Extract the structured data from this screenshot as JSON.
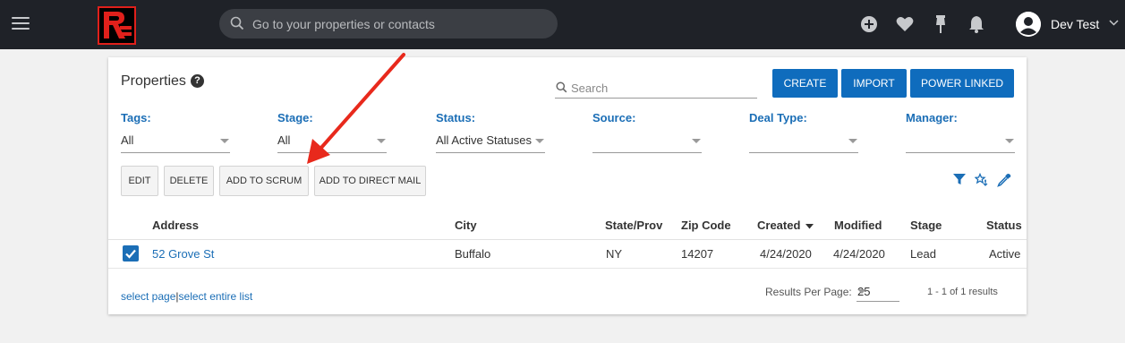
{
  "topbar": {
    "search_placeholder": "Go to your properties or contacts",
    "user_name": "Dev Test",
    "icons": [
      "hamburger-icon",
      "add-circle-icon",
      "heart-icon",
      "pin-icon",
      "bell-icon",
      "user-avatar-icon",
      "chevron-down-icon"
    ]
  },
  "card": {
    "title": "Properties",
    "search_placeholder": "Search",
    "buttons": {
      "create": "CREATE",
      "import": "IMPORT",
      "power_linked": "POWER LINKED"
    },
    "filters": [
      {
        "label": "Tags:",
        "value": "All"
      },
      {
        "label": "Stage:",
        "value": "All"
      },
      {
        "label": "Status:",
        "value": "All Active Statuses"
      },
      {
        "label": "Source:",
        "value": ""
      },
      {
        "label": "Deal Type:",
        "value": ""
      },
      {
        "label": "Manager:",
        "value": ""
      }
    ],
    "actions": {
      "edit": "EDIT",
      "delete": "DELETE",
      "add_to_scrum": "ADD TO SCRUM",
      "add_to_direct_mail": "ADD TO DIRECT MAIL"
    },
    "table": {
      "headers": {
        "address": "Address",
        "city": "City",
        "state": "State/Prov",
        "zip": "Zip Code",
        "created": "Created",
        "modified": "Modified",
        "stage": "Stage",
        "status": "Status"
      },
      "rows": [
        {
          "checked": true,
          "address": "52 Grove St",
          "city": "Buffalo",
          "state": "NY",
          "zip": "14207",
          "created": "4/24/2020",
          "modified": "4/24/2020",
          "stage": "Lead",
          "status": "Active"
        }
      ]
    },
    "footer": {
      "select_page": "select page",
      "separator": "|",
      "select_entire_list": "select entire list",
      "rpp_label": "Results Per Page:",
      "rpp_value": "25",
      "results_text": "1 - 1 of 1 results"
    }
  },
  "colors": {
    "topbar": "#1f2228",
    "primary_button": "#0f6cbd",
    "link": "#1b6eb6",
    "annotation_arrow": "#e8291c",
    "logo_red": "#e0201b"
  }
}
